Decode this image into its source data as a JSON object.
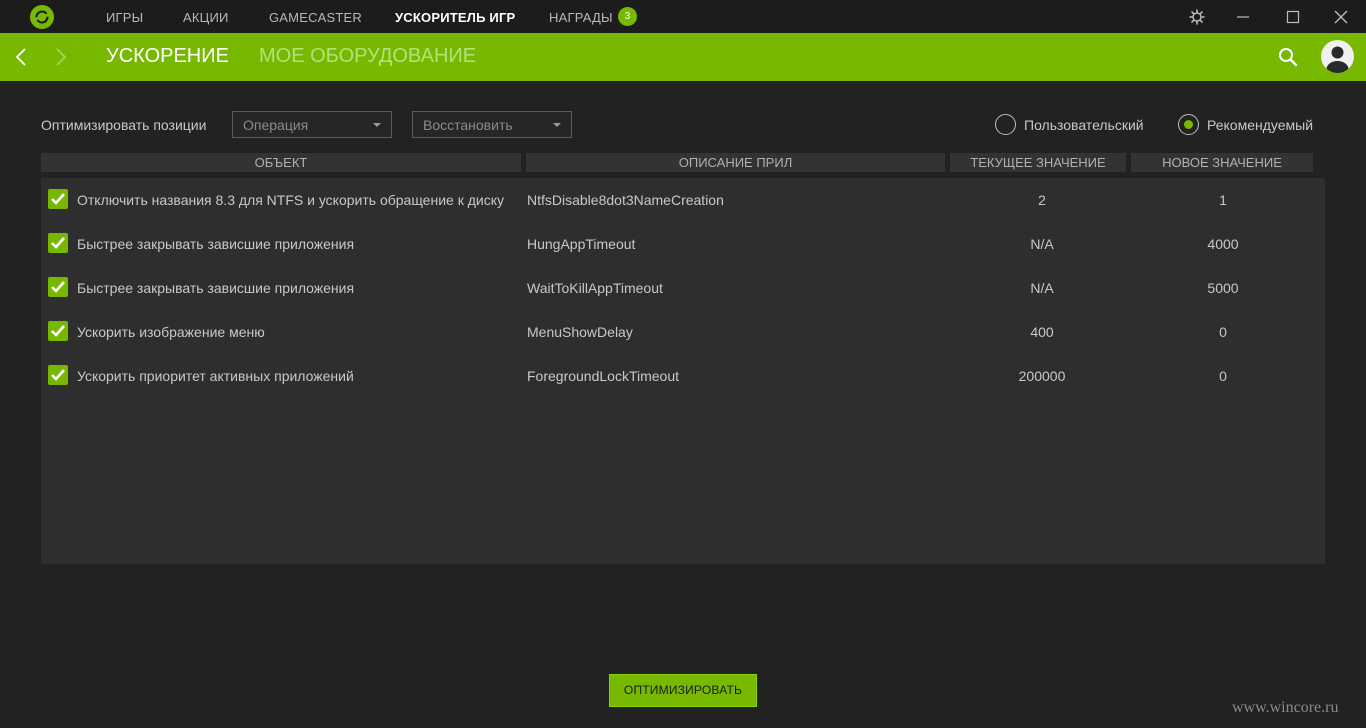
{
  "topnav": {
    "items": [
      {
        "label": "ИГРЫ"
      },
      {
        "label": "АКЦИИ"
      },
      {
        "label": "GAMECASTER"
      },
      {
        "label": "УСКОРИТЕЛЬ ИГР"
      },
      {
        "label": "НАГРАДЫ"
      }
    ],
    "active": "УСКОРИТЕЛЬ ИГР",
    "rewards_badge": "3"
  },
  "subnav": {
    "tabs": [
      {
        "label": "УСКОРЕНИЕ"
      },
      {
        "label": "МОЕ ОБОРУДОВАНИЕ"
      }
    ],
    "active": "УСКОРЕНИЕ"
  },
  "controls": {
    "optimize_label": "Оптимизировать позиции",
    "operation_dropdown": "Операция",
    "restore_dropdown": "Восстановить",
    "radio_custom": "Пользовательский",
    "radio_recommended": "Рекомендуемый",
    "selected_mode": "Рекомендуемый"
  },
  "table": {
    "headers": [
      "ОБЪЕКТ",
      "ОПИСАНИЕ ПРИЛ",
      "ТЕКУЩЕЕ ЗНАЧЕНИЕ",
      "НОВОЕ ЗНАЧЕНИЕ"
    ],
    "rows": [
      {
        "checked": true,
        "object": "Отключить названия 8.3 для NTFS и ускорить обращение к диску",
        "description": "NtfsDisable8dot3NameCreation",
        "current": "2",
        "new": "1"
      },
      {
        "checked": true,
        "object": "Быстрее закрывать зависшие приложения",
        "description": "HungAppTimeout",
        "current": "N/A",
        "new": "4000"
      },
      {
        "checked": true,
        "object": "Быстрее закрывать зависшие приложения",
        "description": "WaitToKillAppTimeout",
        "current": "N/A",
        "new": "5000"
      },
      {
        "checked": true,
        "object": "Ускорить изображение меню",
        "description": "MenuShowDelay",
        "current": "400",
        "new": "0"
      },
      {
        "checked": true,
        "object": "Ускорить приоритет активных приложений",
        "description": "ForegroundLockTimeout",
        "current": "200000",
        "new": "0"
      }
    ]
  },
  "optimize_button": "ОПТИМИЗИРОВАТЬ",
  "watermark": "www.wincore.ru",
  "colors": {
    "accent": "#76b900",
    "background": "#222222",
    "topbar": "#1c1c1c",
    "table_body": "#2e2e2e",
    "header_cell": "#333333"
  },
  "icons": [
    "app-logo-icon",
    "settings-icon",
    "minimize-icon",
    "maximize-icon",
    "close-icon",
    "back-arrow-icon",
    "forward-arrow-icon",
    "search-icon",
    "user-avatar-icon",
    "checkmark-icon",
    "dropdown-caret-icon"
  ]
}
